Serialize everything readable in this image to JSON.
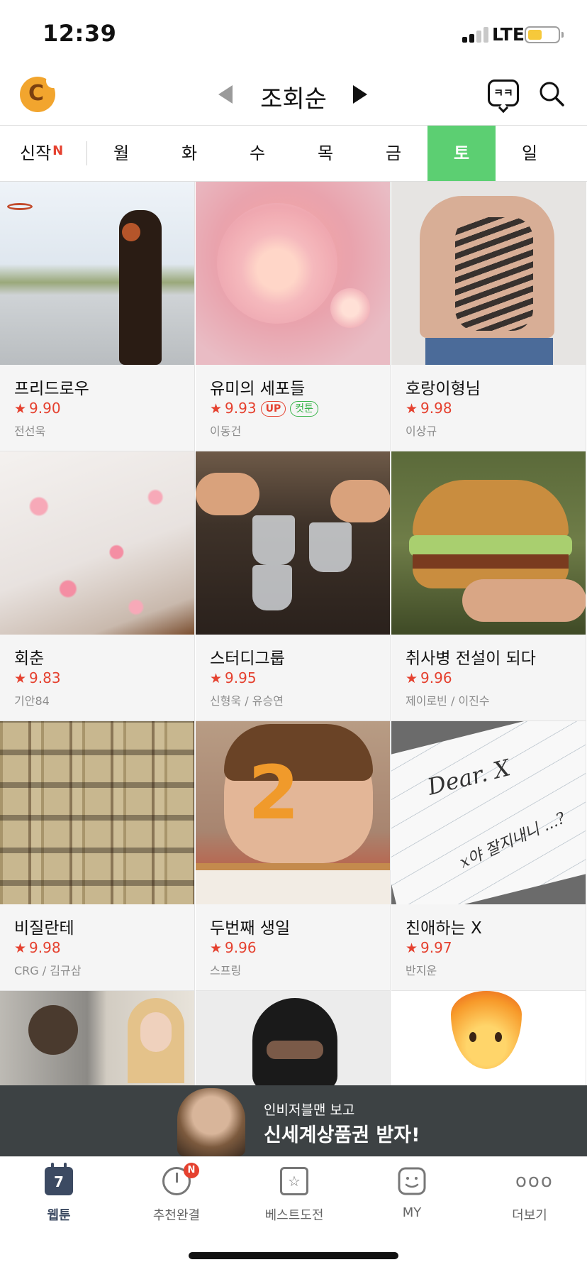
{
  "status_bar": {
    "time": "12:39",
    "network": "LTE"
  },
  "header": {
    "sort_title": "조회순",
    "chat_icon_text": "ㅋㅋ"
  },
  "day_tabs": {
    "new_label": "신작",
    "new_badge": "N",
    "days": [
      "월",
      "화",
      "수",
      "목",
      "금",
      "토",
      "일",
      "월"
    ],
    "active_day": "토"
  },
  "webtoons": [
    {
      "title": "프리드로우",
      "rating": "9.90",
      "author": "전선욱",
      "badges": []
    },
    {
      "title": "유미의 세포들",
      "rating": "9.93",
      "author": "이동건",
      "badges": [
        "UP",
        "컷툰"
      ]
    },
    {
      "title": "호랑이형님",
      "rating": "9.98",
      "author": "이상규",
      "badges": []
    },
    {
      "title": "회춘",
      "rating": "9.83",
      "author": "기안84",
      "badges": []
    },
    {
      "title": "스터디그룹",
      "rating": "9.95",
      "author": "신형욱 / 유승연",
      "badges": []
    },
    {
      "title": "취사병 전설이 되다",
      "rating": "9.96",
      "author": "제이로빈 / 이진수",
      "badges": []
    },
    {
      "title": "비질란테",
      "rating": "9.98",
      "author": "CRG / 김규삼",
      "badges": []
    },
    {
      "title": "두번째 생일",
      "rating": "9.96",
      "author": "스프링",
      "badges": []
    },
    {
      "title": "친애하는 X",
      "rating": "9.97",
      "author": "반지운",
      "badges": []
    }
  ],
  "thumbnail_texts": {
    "dear_x_line1": "Dear. X",
    "dear_x_line2": "x야 잘지내니 ...?",
    "birthday_number": "2"
  },
  "ad_banner": {
    "line1": "인비저블맨 보고",
    "line2": "신세계상품권 받자!"
  },
  "bottom_nav": {
    "items": [
      {
        "label": "웹툰",
        "icon": "calendar-icon",
        "icon_text": "7"
      },
      {
        "label": "추천완결",
        "icon": "clock-icon",
        "badge": "N"
      },
      {
        "label": "베스트도전",
        "icon": "star-box-icon",
        "icon_text": "☆"
      },
      {
        "label": "MY",
        "icon": "smile-icon"
      },
      {
        "label": "더보기",
        "icon": "more-dots-icon",
        "icon_text": "ooo"
      }
    ]
  },
  "colors": {
    "accent_green": "#5ccf72",
    "rating_red": "#e5412f",
    "cuttoon_green": "#39b54a",
    "nav_active": "#3c4a62"
  }
}
